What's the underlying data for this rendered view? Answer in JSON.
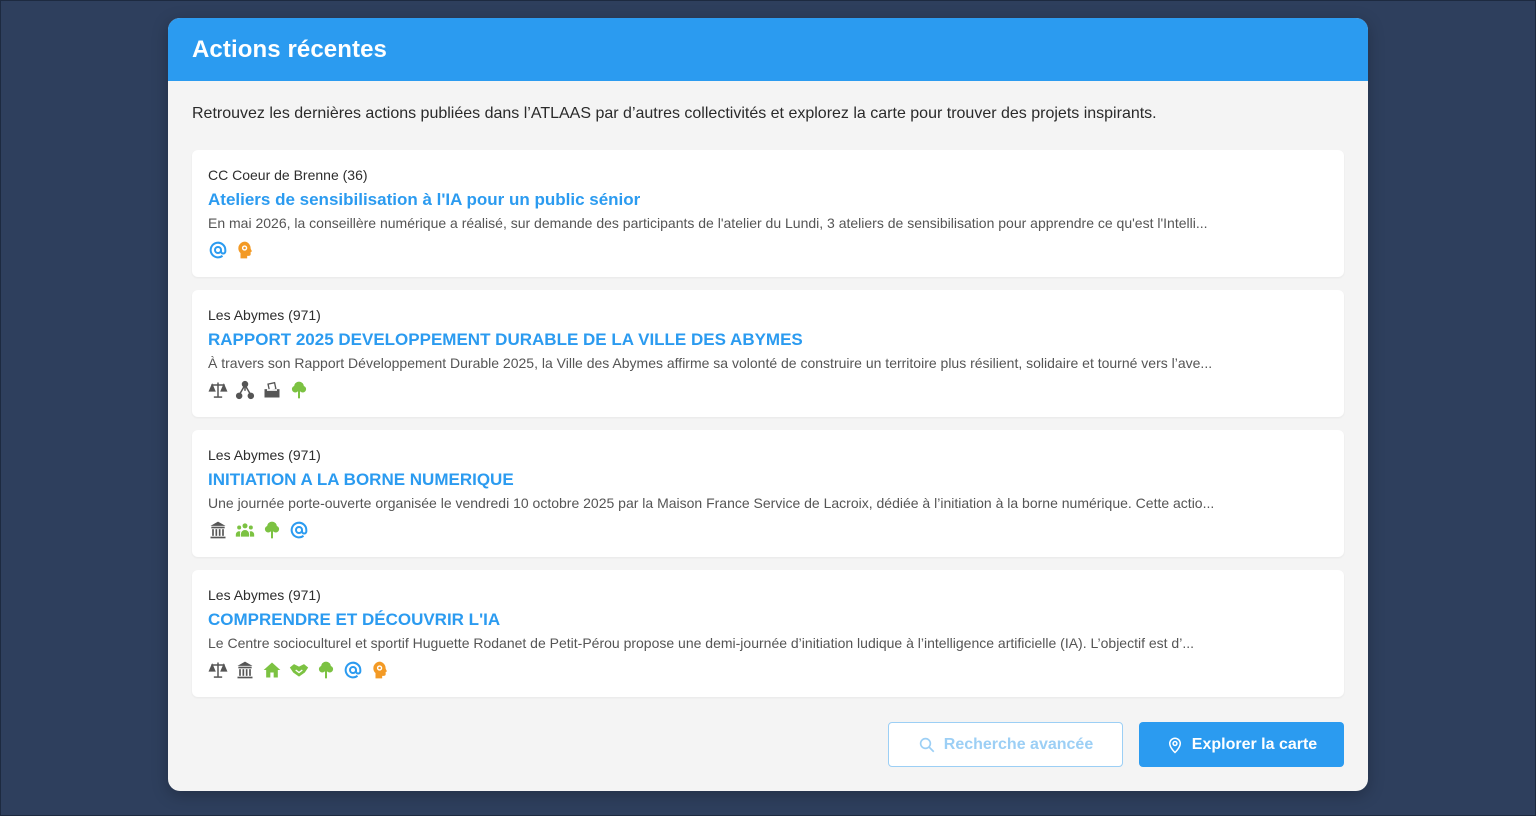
{
  "header": {
    "title": "Actions récentes"
  },
  "intro": "Retrouvez les dernières actions publiées dans l’ATLAAS par d’autres collectivités et explorez la carte pour trouver des projets inspirants.",
  "colors": {
    "accent": "#2b9bf0",
    "green": "#7cc242",
    "orange": "#f39a25",
    "grey_icon": "#555555",
    "background": "#2e3f5d"
  },
  "actions": [
    {
      "location": "CC Coeur de Brenne (36)",
      "title": "Ateliers de sensibilisation à l'IA pour un public sénior",
      "description": "En mai 2026, la conseillère numérique a réalisé, sur demande des participants de l'atelier du Lundi, 3 ateliers de sensibilisation pour apprendre ce qu'est l'Intelli...",
      "icons": [
        "at-icon",
        "head-brain-icon"
      ]
    },
    {
      "location": "Les Abymes (971)",
      "title": "RAPPORT 2025 DEVELOPPEMENT DURABLE DE LA VILLE DES ABYMES",
      "description": "À travers son Rapport Développement Durable 2025, la Ville des Abymes affirme sa volonté de construire un territoire plus résilient, solidaire et tourné vers l’ave...",
      "icons": [
        "balance-scale-icon",
        "network-icon",
        "ballot-box-icon",
        "tree-icon"
      ]
    },
    {
      "location": "Les Abymes (971)",
      "title": "INITIATION A LA BORNE NUMERIQUE",
      "description": "Une journée porte-ouverte organisée le vendredi 10 octobre 2025 par la Maison France Service de Lacroix, dédiée à l’initiation à la borne numérique. Cette actio...",
      "icons": [
        "public-building-icon",
        "people-group-icon",
        "tree-icon",
        "at-icon"
      ]
    },
    {
      "location": "Les Abymes (971)",
      "title": "COMPRENDRE ET DÉCOUVRIR L'IA",
      "description": "Le Centre socioculturel et sportif Huguette Rodanet de Petit-Pérou propose une demi-journée d’initiation ludique à l’intelligence artificielle (IA). L’objectif est d’...",
      "icons": [
        "balance-scale-icon",
        "public-building-icon",
        "house-icon",
        "handshake-icon",
        "tree-icon",
        "at-icon",
        "head-brain-icon"
      ]
    }
  ],
  "buttons": {
    "search_label": "Recherche avancée",
    "map_label": "Explorer la carte"
  }
}
